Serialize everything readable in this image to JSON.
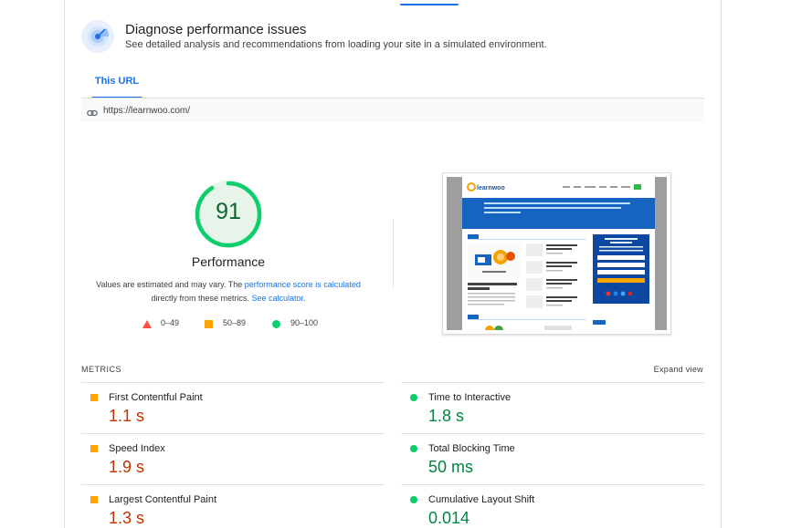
{
  "header": {
    "title": "Diagnose performance issues",
    "subtitle": "See detailed analysis and recommendations from loading your site in a simulated environment.",
    "icon": "radar-icon"
  },
  "tabs": [
    {
      "label": "This URL",
      "active": true
    }
  ],
  "url": {
    "icon": "link-icon",
    "text": "https://learnwoo.com/"
  },
  "score": {
    "value": "91",
    "fraction": 0.91,
    "label": "Performance",
    "color": "#0cce6b"
  },
  "disclaimer": {
    "part1": "Values are estimated and may vary. The ",
    "link1": "performance score is calculated",
    "part2": " directly from these metrics. ",
    "link2": "See calculator",
    "part3": "."
  },
  "legend": [
    {
      "icon": "red-triangle-icon",
      "label": "0–49",
      "color": "#ff4e42"
    },
    {
      "icon": "orange-square-icon",
      "label": "50–89",
      "color": "#ffa400"
    },
    {
      "icon": "green-circle-icon",
      "label": "90–100",
      "color": "#0cce6b"
    }
  ],
  "metrics": {
    "title": "METRICS",
    "expand_label": "Expand view",
    "items": [
      {
        "label": "First Contentful Paint",
        "value": "1.1 s",
        "status": "orange"
      },
      {
        "label": "Time to Interactive",
        "value": "1.8 s",
        "status": "green"
      },
      {
        "label": "Speed Index",
        "value": "1.9 s",
        "status": "orange"
      },
      {
        "label": "Total Blocking Time",
        "value": "50 ms",
        "status": "green"
      },
      {
        "label": "Largest Contentful Paint",
        "value": "1.3 s",
        "status": "orange"
      },
      {
        "label": "Cumulative Layout Shift",
        "value": "0.014",
        "status": "green"
      }
    ]
  },
  "screenshot": {
    "logo": "learnwoo",
    "nav": [
      "HOME",
      "BLOG",
      "WOOCOMMERCE",
      "THEMES",
      "DEALS",
      "PRODUCTS"
    ],
    "sidebar_title": "Expand your knowledge of eCommerce",
    "article_title": "How to Plan for Creating The BIG Budget"
  },
  "colors": {
    "accent": "#1a73e8",
    "pass": "#0cce6b",
    "average": "#ffa400",
    "fail": "#ff4e42"
  }
}
